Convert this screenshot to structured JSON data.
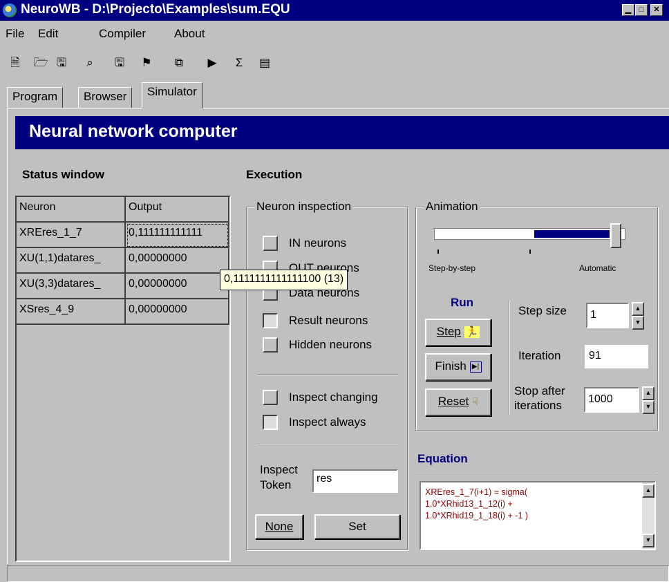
{
  "window": {
    "title": "NeuroWB - D:\\Projecto\\Examples\\sum.EQU",
    "min_glyph": "▁",
    "max_glyph": "□",
    "close_glyph": "✕"
  },
  "menu": [
    "File",
    "Edit",
    "Compiler",
    "About"
  ],
  "toolbar": {
    "icons": [
      "new-file-icon",
      "open-file-icon",
      "save-icon",
      "find-icon",
      "compile-icon",
      "check-icon",
      "network-icon",
      "run-icon",
      "sum-icon",
      "report-icon"
    ],
    "glyphs": [
      "🗎",
      "🗁",
      "🖫",
      "⌕",
      "🖫",
      "⚑",
      "⧉",
      "▶",
      "Σ",
      "▤"
    ]
  },
  "tabs": [
    {
      "label": "Program",
      "active": false
    },
    {
      "label": "Browser",
      "active": false
    },
    {
      "label": "Simulator",
      "active": true
    }
  ],
  "banner": "Neural network computer",
  "status": {
    "title": "Status window",
    "headers": [
      "Neuron",
      "Output"
    ],
    "rows": [
      {
        "neuron": "XREres_1_7",
        "output": "0,111111111111"
      },
      {
        "neuron": "XU(1,1)datares_",
        "output": "0,00000000"
      },
      {
        "neuron": "XU(3,3)datares_",
        "output": "0,00000000"
      },
      {
        "neuron": "XSres_4_9",
        "output": "0,00000000"
      }
    ],
    "tooltip": "0,1111111111111100 (13)"
  },
  "execution": {
    "title": "Execution",
    "inspection": {
      "label": "Neuron inspection",
      "options": [
        {
          "label": "IN neurons",
          "checked": false
        },
        {
          "label": "OUT neurons",
          "checked": false
        },
        {
          "label": "Data neurons",
          "checked": false
        },
        {
          "label": "Result neurons",
          "checked": true
        },
        {
          "label": "Hidden neurons",
          "checked": false
        }
      ],
      "modes": [
        {
          "label": "Inspect changing",
          "checked": false
        },
        {
          "label": "Inspect always",
          "checked": true
        }
      ],
      "token_label_1": "Inspect",
      "token_label_2": "Token",
      "token_value": "res",
      "none_label": "None",
      "set_label": "Set"
    },
    "animation": {
      "label": "Animation",
      "slider_level": 0.95,
      "left_label": "Step-by-step",
      "right_label": "Automatic",
      "run_label": "Run",
      "step_label": "Step",
      "finish_label": "Finish",
      "reset_label": "Reset",
      "step_size_label": "Step size",
      "step_size_value": "1",
      "iteration_label": "Iteration",
      "iteration_value": "91",
      "stop_after_label_1": "Stop after",
      "stop_after_label_2": "iterations",
      "stop_after_value": "1000"
    },
    "equation": {
      "title": "Equation",
      "text": "XREres_1_7(i+1) = sigma(\n1.0*XRhid13_1_12(i) +\n1.0*XRhid19_1_18(i) + -1 )"
    }
  },
  "colors": {
    "title_bar": "#000080",
    "window_face": "#c0c0c0",
    "equation_text": "#8b0000",
    "run_label": "#000080"
  }
}
